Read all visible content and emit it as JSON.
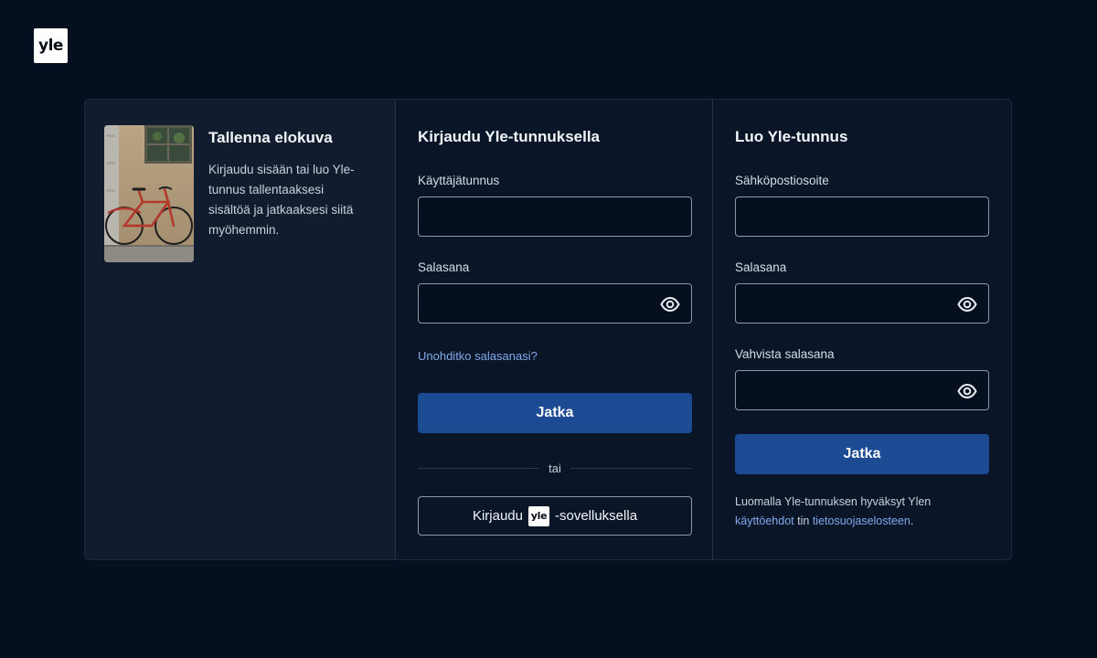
{
  "brand": {
    "logo_text": "yle"
  },
  "promo": {
    "title": "Tallenna elokuva",
    "body": "Kirjaudu sisään tai luo Yle-tunnus tallentaaksesi sisältöä ja jatkaaksesi siitä myöhemmin."
  },
  "login": {
    "title": "Kirjaudu Yle-tunnuksella",
    "username_label": "Käyttäjätunnus",
    "username_value": "",
    "password_label": "Salasana",
    "password_value": "",
    "forgot_link": "Unohditko salasanasi?",
    "submit_label": "Jatka",
    "divider_text": "tai",
    "app_login_prefix": "Kirjaudu",
    "app_login_logo": "yle",
    "app_login_suffix": "-sovelluksella"
  },
  "register": {
    "title": "Luo Yle-tunnus",
    "email_label": "Sähköpostiosoite",
    "email_value": "",
    "password_label": "Salasana",
    "password_value": "",
    "confirm_label": "Vahvista salasana",
    "confirm_value": "",
    "submit_label": "Jatka",
    "terms_prefix": "Luomalla Yle-tunnuksen hyväksyt Ylen",
    "terms_link": "käyttöehdot",
    "terms_middle": "tin",
    "privacy_link": "tietosuojaselosteen",
    "terms_suffix": "."
  },
  "icons": {
    "show_password": "eye-icon"
  },
  "colors": {
    "background": "#060f1f",
    "card": "#0a1628",
    "promo_panel": "#111c2e",
    "primary_button": "#1c4b93",
    "link": "#7fa9ec",
    "input_border": "#8e98a8"
  }
}
